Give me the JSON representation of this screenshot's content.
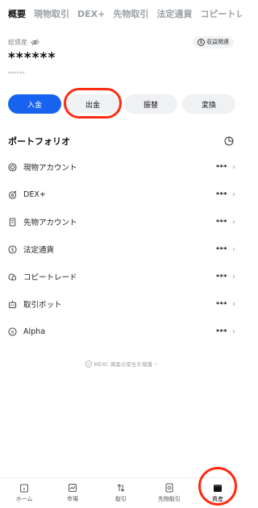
{
  "tabs": [
    {
      "label": "概要",
      "active": true
    },
    {
      "label": "現物取引",
      "active": false
    },
    {
      "label": "DEX+",
      "active": false
    },
    {
      "label": "先物取引",
      "active": false
    },
    {
      "label": "法定通貨",
      "active": false
    },
    {
      "label": "コピートレード",
      "active": false
    }
  ],
  "total": {
    "label": "総資産",
    "masked_value": "******",
    "masked_sub": "******",
    "profit_button": "収益関連"
  },
  "actions": {
    "deposit": "入金",
    "withdraw": "出金",
    "transfer": "振替",
    "convert": "変換"
  },
  "portfolio": {
    "title": "ポートフォリオ",
    "items": [
      {
        "label": "現物アカウント",
        "value": "***",
        "icon": "spot-icon"
      },
      {
        "label": "DEX+",
        "value": "***",
        "icon": "dex-icon"
      },
      {
        "label": "先物アカウント",
        "value": "***",
        "icon": "futures-icon"
      },
      {
        "label": "法定通貨",
        "value": "***",
        "icon": "fiat-icon"
      },
      {
        "label": "コピートレード",
        "value": "***",
        "icon": "copy-trade-icon"
      },
      {
        "label": "取引ボット",
        "value": "***",
        "icon": "bot-icon"
      },
      {
        "label": "Alpha",
        "value": "***",
        "icon": "alpha-icon"
      }
    ]
  },
  "safety_link": "MEXC 資産の安全を保護",
  "bottom_nav": [
    {
      "label": "ホーム",
      "icon": "home-icon"
    },
    {
      "label": "市場",
      "icon": "market-icon"
    },
    {
      "label": "取引",
      "icon": "trade-icon"
    },
    {
      "label": "先物取引",
      "icon": "futures-nav-icon"
    },
    {
      "label": "資産",
      "icon": "wallet-icon",
      "active": true
    }
  ],
  "highlight_color": "#ff2a12",
  "accent_color": "#1763f0"
}
